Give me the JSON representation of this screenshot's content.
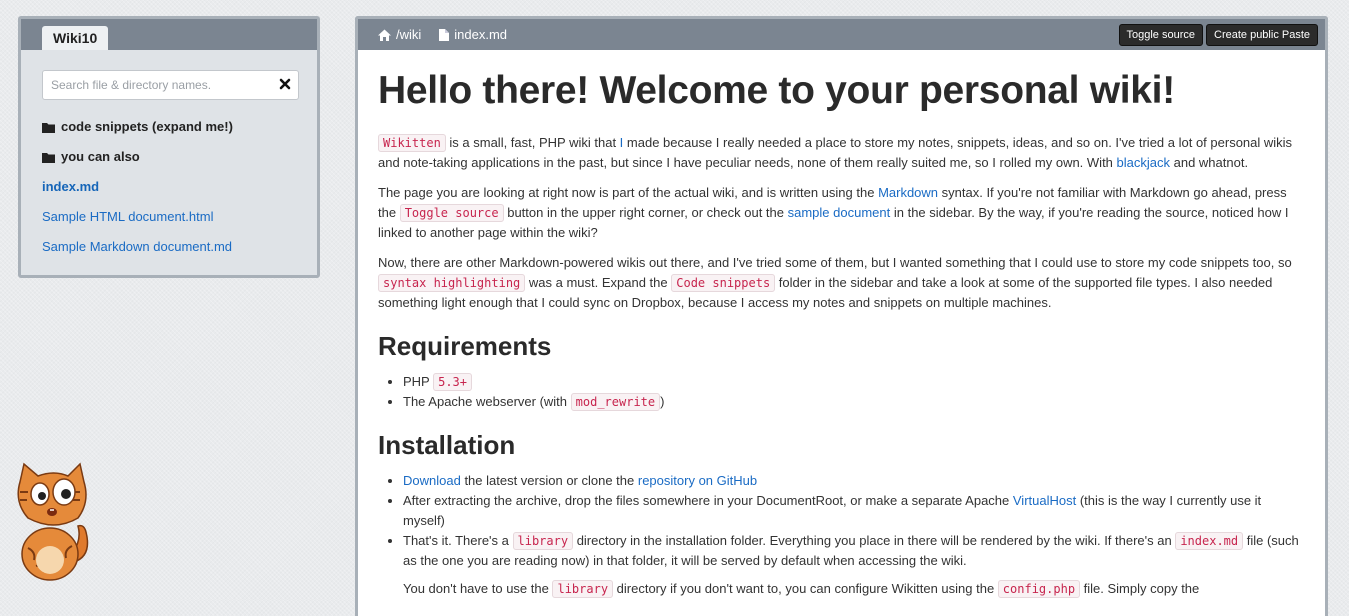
{
  "sidebar": {
    "tab_label": "Wiki10",
    "search_placeholder": "Search file & directory names.",
    "items": [
      {
        "label": "code snippets (expand me!)",
        "type": "dir"
      },
      {
        "label": "you can also",
        "type": "dir"
      },
      {
        "label": "index.md",
        "type": "file-active"
      },
      {
        "label": "Sample HTML document.html",
        "type": "file"
      },
      {
        "label": "Sample Markdown document.md",
        "type": "file"
      }
    ]
  },
  "header": {
    "crumb_wiki": "/wiki",
    "crumb_file": "index.md",
    "toggle_source_label": "Toggle source",
    "create_paste_label": "Create public Paste"
  },
  "article": {
    "title": "Hello there! Welcome to your personal wiki!",
    "p1": {
      "code_wikitten": "Wikitten",
      "t1": " is a small, fast, PHP wiki that ",
      "link_i": "I",
      "t2": " made because I really needed a place to store my notes, snippets, ideas, and so on. I've tried a lot of personal wikis and note-taking applications in the past, but since I have peculiar needs, none of them really suited me, so I rolled my own. With ",
      "link_blackjack": "blackjack",
      "t3": " and whatnot."
    },
    "p2": {
      "t1": "The page you are looking at right now is part of the actual wiki, and is written using the ",
      "link_markdown": "Markdown",
      "t2": " syntax. If you're not familiar with Markdown go ahead, press the ",
      "code_toggle": "Toggle source",
      "t3": " button in the upper right corner, or check out the ",
      "link_sample": "sample document",
      "t4": " in the sidebar. By the way, if you're reading the source, noticed how I linked to another page within the wiki?"
    },
    "p3": {
      "t1": "Now, there are other Markdown-powered wikis out there, and I've tried some of them, but I wanted something that I could use to store my code snippets too, so ",
      "code_syntax": "syntax highlighting",
      "t2": " was a must. Expand the ",
      "code_snippets": "Code snippets",
      "t3": " folder in the sidebar and take a look at some of the supported file types. I also needed something light enough that I could sync on Dropbox, because I access my notes and snippets on multiple machines."
    },
    "requirements": {
      "heading": "Requirements",
      "item1_text": "PHP ",
      "item1_code": "5.3+",
      "item2_text1": "The Apache webserver (with ",
      "item2_code": "mod_rewrite",
      "item2_text2": ")"
    },
    "installation": {
      "heading": "Installation",
      "item1_link": "Download",
      "item1_t1": " the latest version or clone the ",
      "item1_link2": "repository on GitHub",
      "item2_t1": "After extracting the archive, drop the files somewhere in your DocumentRoot, or make a separate Apache ",
      "item2_link": "VirtualHost",
      "item2_t2": " (this is the way I currently use it myself)",
      "item3_t1": "That's it. There's a ",
      "item3_code1": "library",
      "item3_t2": " directory in the installation folder. Everything you place in there will be rendered by the wiki. If there's an ",
      "item3_code2": "index.md",
      "item3_t3": " file (such as the one you are reading now) in that folder, it will be served by default when accessing the wiki.",
      "p_t1": "You don't have to use the ",
      "p_code1": "library",
      "p_t2": " directory if you don't want to, you can configure Wikitten using the ",
      "p_code2": "config.php",
      "p_t3": " file. Simply copy the"
    }
  },
  "colors": {
    "header_bar": "#7b8591",
    "link": "#1a6bc4",
    "code_text": "#c7254e",
    "button_bg": "#2b2b2b"
  }
}
